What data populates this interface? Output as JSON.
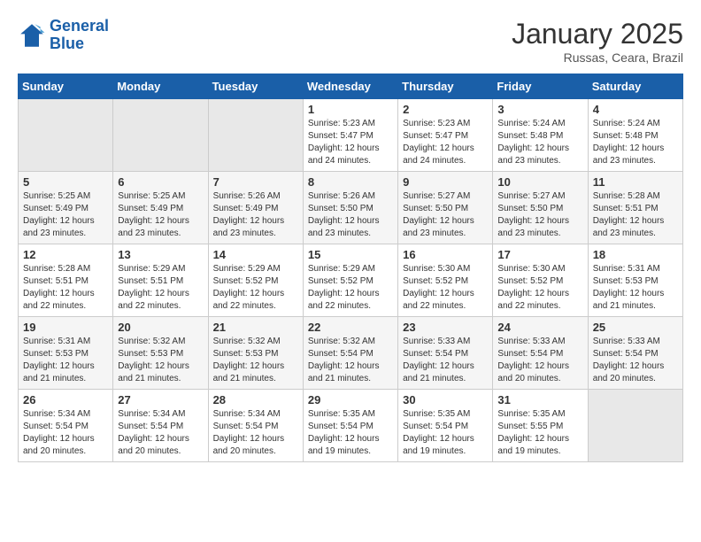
{
  "header": {
    "logo_line1": "General",
    "logo_line2": "Blue",
    "title": "January 2025",
    "subtitle": "Russas, Ceara, Brazil"
  },
  "days_of_week": [
    "Sunday",
    "Monday",
    "Tuesday",
    "Wednesday",
    "Thursday",
    "Friday",
    "Saturday"
  ],
  "weeks": [
    {
      "days": [
        {
          "num": "",
          "info": ""
        },
        {
          "num": "",
          "info": ""
        },
        {
          "num": "",
          "info": ""
        },
        {
          "num": "1",
          "info": "Sunrise: 5:23 AM\nSunset: 5:47 PM\nDaylight: 12 hours\nand 24 minutes."
        },
        {
          "num": "2",
          "info": "Sunrise: 5:23 AM\nSunset: 5:47 PM\nDaylight: 12 hours\nand 24 minutes."
        },
        {
          "num": "3",
          "info": "Sunrise: 5:24 AM\nSunset: 5:48 PM\nDaylight: 12 hours\nand 23 minutes."
        },
        {
          "num": "4",
          "info": "Sunrise: 5:24 AM\nSunset: 5:48 PM\nDaylight: 12 hours\nand 23 minutes."
        }
      ]
    },
    {
      "days": [
        {
          "num": "5",
          "info": "Sunrise: 5:25 AM\nSunset: 5:49 PM\nDaylight: 12 hours\nand 23 minutes."
        },
        {
          "num": "6",
          "info": "Sunrise: 5:25 AM\nSunset: 5:49 PM\nDaylight: 12 hours\nand 23 minutes."
        },
        {
          "num": "7",
          "info": "Sunrise: 5:26 AM\nSunset: 5:49 PM\nDaylight: 12 hours\nand 23 minutes."
        },
        {
          "num": "8",
          "info": "Sunrise: 5:26 AM\nSunset: 5:50 PM\nDaylight: 12 hours\nand 23 minutes."
        },
        {
          "num": "9",
          "info": "Sunrise: 5:27 AM\nSunset: 5:50 PM\nDaylight: 12 hours\nand 23 minutes."
        },
        {
          "num": "10",
          "info": "Sunrise: 5:27 AM\nSunset: 5:50 PM\nDaylight: 12 hours\nand 23 minutes."
        },
        {
          "num": "11",
          "info": "Sunrise: 5:28 AM\nSunset: 5:51 PM\nDaylight: 12 hours\nand 23 minutes."
        }
      ]
    },
    {
      "days": [
        {
          "num": "12",
          "info": "Sunrise: 5:28 AM\nSunset: 5:51 PM\nDaylight: 12 hours\nand 22 minutes."
        },
        {
          "num": "13",
          "info": "Sunrise: 5:29 AM\nSunset: 5:51 PM\nDaylight: 12 hours\nand 22 minutes."
        },
        {
          "num": "14",
          "info": "Sunrise: 5:29 AM\nSunset: 5:52 PM\nDaylight: 12 hours\nand 22 minutes."
        },
        {
          "num": "15",
          "info": "Sunrise: 5:29 AM\nSunset: 5:52 PM\nDaylight: 12 hours\nand 22 minutes."
        },
        {
          "num": "16",
          "info": "Sunrise: 5:30 AM\nSunset: 5:52 PM\nDaylight: 12 hours\nand 22 minutes."
        },
        {
          "num": "17",
          "info": "Sunrise: 5:30 AM\nSunset: 5:52 PM\nDaylight: 12 hours\nand 22 minutes."
        },
        {
          "num": "18",
          "info": "Sunrise: 5:31 AM\nSunset: 5:53 PM\nDaylight: 12 hours\nand 21 minutes."
        }
      ]
    },
    {
      "days": [
        {
          "num": "19",
          "info": "Sunrise: 5:31 AM\nSunset: 5:53 PM\nDaylight: 12 hours\nand 21 minutes."
        },
        {
          "num": "20",
          "info": "Sunrise: 5:32 AM\nSunset: 5:53 PM\nDaylight: 12 hours\nand 21 minutes."
        },
        {
          "num": "21",
          "info": "Sunrise: 5:32 AM\nSunset: 5:53 PM\nDaylight: 12 hours\nand 21 minutes."
        },
        {
          "num": "22",
          "info": "Sunrise: 5:32 AM\nSunset: 5:54 PM\nDaylight: 12 hours\nand 21 minutes."
        },
        {
          "num": "23",
          "info": "Sunrise: 5:33 AM\nSunset: 5:54 PM\nDaylight: 12 hours\nand 21 minutes."
        },
        {
          "num": "24",
          "info": "Sunrise: 5:33 AM\nSunset: 5:54 PM\nDaylight: 12 hours\nand 20 minutes."
        },
        {
          "num": "25",
          "info": "Sunrise: 5:33 AM\nSunset: 5:54 PM\nDaylight: 12 hours\nand 20 minutes."
        }
      ]
    },
    {
      "days": [
        {
          "num": "26",
          "info": "Sunrise: 5:34 AM\nSunset: 5:54 PM\nDaylight: 12 hours\nand 20 minutes."
        },
        {
          "num": "27",
          "info": "Sunrise: 5:34 AM\nSunset: 5:54 PM\nDaylight: 12 hours\nand 20 minutes."
        },
        {
          "num": "28",
          "info": "Sunrise: 5:34 AM\nSunset: 5:54 PM\nDaylight: 12 hours\nand 20 minutes."
        },
        {
          "num": "29",
          "info": "Sunrise: 5:35 AM\nSunset: 5:54 PM\nDaylight: 12 hours\nand 19 minutes."
        },
        {
          "num": "30",
          "info": "Sunrise: 5:35 AM\nSunset: 5:54 PM\nDaylight: 12 hours\nand 19 minutes."
        },
        {
          "num": "31",
          "info": "Sunrise: 5:35 AM\nSunset: 5:55 PM\nDaylight: 12 hours\nand 19 minutes."
        },
        {
          "num": "",
          "info": ""
        }
      ]
    }
  ]
}
